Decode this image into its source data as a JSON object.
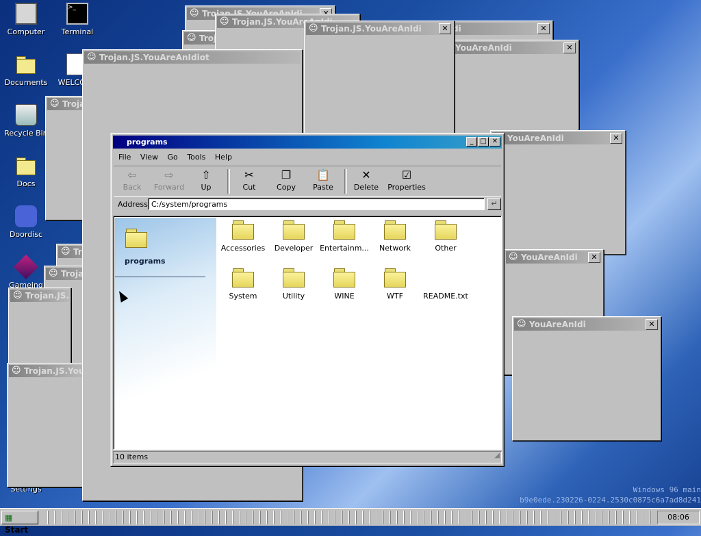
{
  "desktop": {
    "icons": [
      {
        "label": "Computer",
        "icon": "computer-icon"
      },
      {
        "label": "Terminal",
        "icon": "terminal-icon"
      },
      {
        "label": "Documents",
        "icon": "folder-icon"
      },
      {
        "label": "WELCOME",
        "icon": "document-icon"
      },
      {
        "label": "Recycle Bin",
        "icon": "recycle-bin-icon"
      },
      {
        "label": "Docs",
        "icon": "folder-icon"
      },
      {
        "label": "Doordisc",
        "icon": "discord-icon"
      },
      {
        "label": "Gameing",
        "icon": "game-cube-icon"
      },
      {
        "label": "Settings",
        "icon": "settings-icon"
      }
    ],
    "trojan_window_title": "Trojan.JS.YouAreAnIdiot",
    "trojan_window_title_partial": "Trojan.JS.YouAreAnIdi",
    "trojan_window_title_short": "YouAreAnIdi",
    "close_glyph": "✕",
    "watermark_line1": "Windows 96 main",
    "watermark_line2": "b9e0ede.230226-0224.2530c0875c6a7ad8d241"
  },
  "explorer": {
    "title": "programs",
    "menu": [
      "File",
      "View",
      "Go",
      "Tools",
      "Help"
    ],
    "toolbar": [
      {
        "label": "Back",
        "icon": "back-arrow-icon",
        "enabled": false
      },
      {
        "label": "Forward",
        "icon": "forward-arrow-icon",
        "enabled": false
      },
      {
        "label": "Up",
        "icon": "up-folder-icon",
        "enabled": true
      },
      {
        "label": "Cut",
        "icon": "scissors-icon",
        "enabled": true
      },
      {
        "label": "Copy",
        "icon": "copy-icon",
        "enabled": true
      },
      {
        "label": "Paste",
        "icon": "paste-icon",
        "enabled": true
      },
      {
        "label": "Delete",
        "icon": "delete-x-icon",
        "enabled": true
      },
      {
        "label": "Properties",
        "icon": "properties-icon",
        "enabled": true
      }
    ],
    "address_label": "Address",
    "address_value": "C:/system/programs",
    "sidebar_title": "programs",
    "items": [
      {
        "name": "Accessories",
        "type": "folder"
      },
      {
        "name": "Developer",
        "type": "folder"
      },
      {
        "name": "Entertainm...",
        "type": "folder"
      },
      {
        "name": "Network",
        "type": "folder"
      },
      {
        "name": "Other",
        "type": "folder"
      },
      {
        "name": "System",
        "type": "folder"
      },
      {
        "name": "Utility",
        "type": "folder"
      },
      {
        "name": "WINE",
        "type": "folder"
      },
      {
        "name": "WTF",
        "type": "folder"
      },
      {
        "name": "README.txt",
        "type": "file"
      }
    ],
    "status": "10 items"
  },
  "taskbar": {
    "start_label": "Start",
    "clock": "08:06"
  }
}
